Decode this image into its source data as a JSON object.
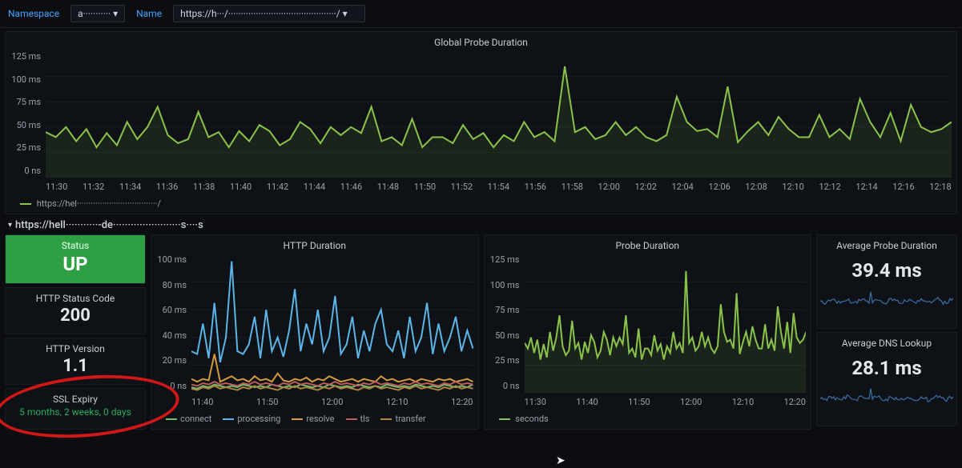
{
  "vars": {
    "namespace_label": "Namespace",
    "namespace_value": "a··········· ▾",
    "name_label": "Name",
    "name_value": "https://h···/···········································/ ▾"
  },
  "top_chart_title": "Global Probe Duration",
  "top_legend_series": "https://hel···································/",
  "row_heading": "https://hell···········-de·······················s····s",
  "status": {
    "label": "Status",
    "value": "UP",
    "http_code_label": "HTTP Status Code",
    "http_code_value": "200",
    "http_ver_label": "HTTP Version",
    "http_ver_value": "1.1",
    "ssl_label": "SSL Expiry",
    "ssl_value": "5 months, 2 weeks, 0 days"
  },
  "http_dur_title": "HTTP Duration",
  "probe_dur_title": "Probe Duration",
  "right": {
    "avg_probe_label": "Average Probe Duration",
    "avg_probe_value": "39.4 ms",
    "avg_dns_label": "Average DNS Lookup",
    "avg_dns_value": "28.1 ms"
  },
  "legend_http": [
    "connect",
    "processing",
    "resolve",
    "tls",
    "transfer"
  ],
  "legend_http_colors": [
    "#6fbf6f",
    "#5bb5e8",
    "#d49a3f",
    "#c05c5c",
    "#b08540"
  ],
  "legend_probe": "seconds",
  "colors": {
    "green_line": "#8bc34a",
    "green_fill": "rgba(139,195,74,0.10)",
    "blue_line": "#5bb5e8",
    "yellow_line": "#d49a3f",
    "spark_blue": "#3b6fa6"
  },
  "chart_data": [
    {
      "id": "global_probe_duration",
      "type": "line",
      "title": "Global Probe Duration",
      "x_ticks": [
        "11:30",
        "11:32",
        "11:34",
        "11:36",
        "11:38",
        "11:40",
        "11:42",
        "11:44",
        "11:46",
        "11:48",
        "11:50",
        "11:52",
        "11:54",
        "11:56",
        "11:58",
        "12:00",
        "12:02",
        "12:04",
        "12:06",
        "12:08",
        "12:10",
        "12:12",
        "12:14",
        "12:16",
        "12:18"
      ],
      "y_ticks": [
        "0 ns",
        "25 ms",
        "50 ms",
        "75 ms",
        "100 ms",
        "125 ms"
      ],
      "ylim": [
        0,
        125
      ],
      "ylabel": "",
      "series": [
        {
          "name": "https://hel…/",
          "color": "#8bc34a",
          "values": [
            45,
            40,
            50,
            36,
            48,
            30,
            44,
            32,
            55,
            38,
            50,
            70,
            42,
            34,
            38,
            65,
            40,
            45,
            30,
            46,
            36,
            52,
            46,
            32,
            38,
            55,
            48,
            34,
            50,
            42,
            50,
            44,
            70,
            36,
            40,
            32,
            58,
            30,
            40,
            40,
            34,
            52,
            38,
            44,
            30,
            42,
            36,
            55,
            40,
            45,
            36,
            110,
            45,
            50,
            38,
            42,
            55,
            42,
            50,
            40,
            36,
            42,
            80,
            55,
            46,
            48,
            40,
            90,
            35,
            46,
            55,
            42,
            60,
            48,
            40,
            40,
            62,
            40,
            48,
            38,
            78,
            55,
            40,
            64,
            36,
            72,
            50,
            45,
            48,
            55
          ]
        }
      ]
    },
    {
      "id": "http_duration",
      "type": "line",
      "title": "HTTP Duration",
      "x_ticks": [
        "11:40",
        "11:50",
        "12:00",
        "12:10",
        "12:20"
      ],
      "y_ticks": [
        "0 ns",
        "20 ms",
        "40 ms",
        "60 ms",
        "80 ms",
        "100 ms"
      ],
      "ylim": [
        0,
        100
      ],
      "series": [
        {
          "name": "connect",
          "color": "#6fbf6f",
          "values": [
            4,
            3,
            5,
            4,
            6,
            5,
            4,
            5,
            4,
            6,
            5,
            4,
            5,
            4,
            6,
            5,
            4,
            5,
            4,
            6,
            5,
            4,
            5,
            4,
            6,
            5,
            4,
            5,
            4,
            6,
            5,
            4,
            5,
            4,
            6,
            5,
            4,
            5,
            4,
            6,
            5,
            4,
            5,
            4,
            6,
            5,
            4,
            5,
            4,
            6
          ]
        },
        {
          "name": "processing",
          "color": "#5bb5e8",
          "values": [
            30,
            28,
            50,
            25,
            65,
            22,
            40,
            95,
            30,
            28,
            35,
            55,
            25,
            60,
            30,
            40,
            26,
            45,
            75,
            30,
            50,
            35,
            60,
            30,
            40,
            70,
            28,
            35,
            55,
            25,
            45,
            30,
            50,
            60,
            35,
            30,
            45,
            25,
            55,
            30,
            40,
            65,
            28,
            50,
            30,
            40,
            55,
            30,
            45,
            32
          ]
        },
        {
          "name": "resolve",
          "color": "#d49a3f",
          "values": [
            10,
            8,
            10,
            9,
            28,
            8,
            10,
            12,
            9,
            10,
            8,
            12,
            9,
            10,
            8,
            14,
            9,
            8,
            10,
            9,
            11,
            8,
            10,
            9,
            12,
            10,
            8,
            9,
            10,
            8,
            10,
            9,
            8,
            12,
            9,
            10,
            8,
            9,
            10,
            8,
            10,
            9,
            8,
            10,
            9,
            10,
            8,
            9,
            10,
            8
          ]
        },
        {
          "name": "tls",
          "color": "#c05c5c",
          "values": [
            6,
            5,
            7,
            6,
            8,
            6,
            7,
            6,
            5,
            7,
            6,
            8,
            6,
            7,
            6,
            5,
            7,
            6,
            8,
            6,
            7,
            6,
            5,
            7,
            6,
            8,
            6,
            7,
            6,
            5,
            7,
            6,
            8,
            6,
            7,
            6,
            5,
            7,
            6,
            8,
            6,
            7,
            6,
            5,
            7,
            6,
            8,
            6,
            7,
            6
          ]
        },
        {
          "name": "transfer",
          "color": "#b08540",
          "values": [
            3,
            2,
            4,
            3,
            5,
            3,
            4,
            3,
            2,
            4,
            3,
            5,
            3,
            4,
            3,
            2,
            4,
            3,
            5,
            3,
            4,
            3,
            2,
            4,
            3,
            5,
            3,
            4,
            3,
            2,
            4,
            3,
            5,
            3,
            4,
            3,
            2,
            4,
            3,
            5,
            3,
            4,
            3,
            2,
            4,
            3,
            5,
            3,
            4,
            3
          ]
        }
      ]
    },
    {
      "id": "probe_duration",
      "type": "line",
      "title": "Probe Duration",
      "x_ticks": [
        "11:30",
        "11:40",
        "11:50",
        "12:00",
        "12:10",
        "12:20"
      ],
      "y_ticks": [
        "0 ns",
        "25 ms",
        "50 ms",
        "75 ms",
        "100 ms",
        "125 ms"
      ],
      "ylim": [
        0,
        125
      ],
      "series": [
        {
          "name": "seconds",
          "color": "#8bc34a",
          "values": [
            45,
            40,
            50,
            36,
            48,
            30,
            44,
            32,
            55,
            38,
            50,
            70,
            42,
            34,
            38,
            65,
            40,
            45,
            30,
            46,
            36,
            52,
            46,
            32,
            38,
            55,
            48,
            34,
            50,
            42,
            50,
            44,
            70,
            36,
            40,
            32,
            58,
            30,
            40,
            40,
            34,
            52,
            38,
            44,
            30,
            42,
            36,
            55,
            40,
            45,
            36,
            110,
            45,
            50,
            38,
            42,
            55,
            42,
            50,
            40,
            36,
            42,
            80,
            55,
            46,
            48,
            40,
            90,
            35,
            46,
            55,
            42,
            60,
            48,
            40,
            40,
            62,
            40,
            48,
            38,
            78,
            55,
            40,
            64,
            36,
            72,
            50,
            45,
            48,
            55
          ]
        }
      ]
    }
  ]
}
